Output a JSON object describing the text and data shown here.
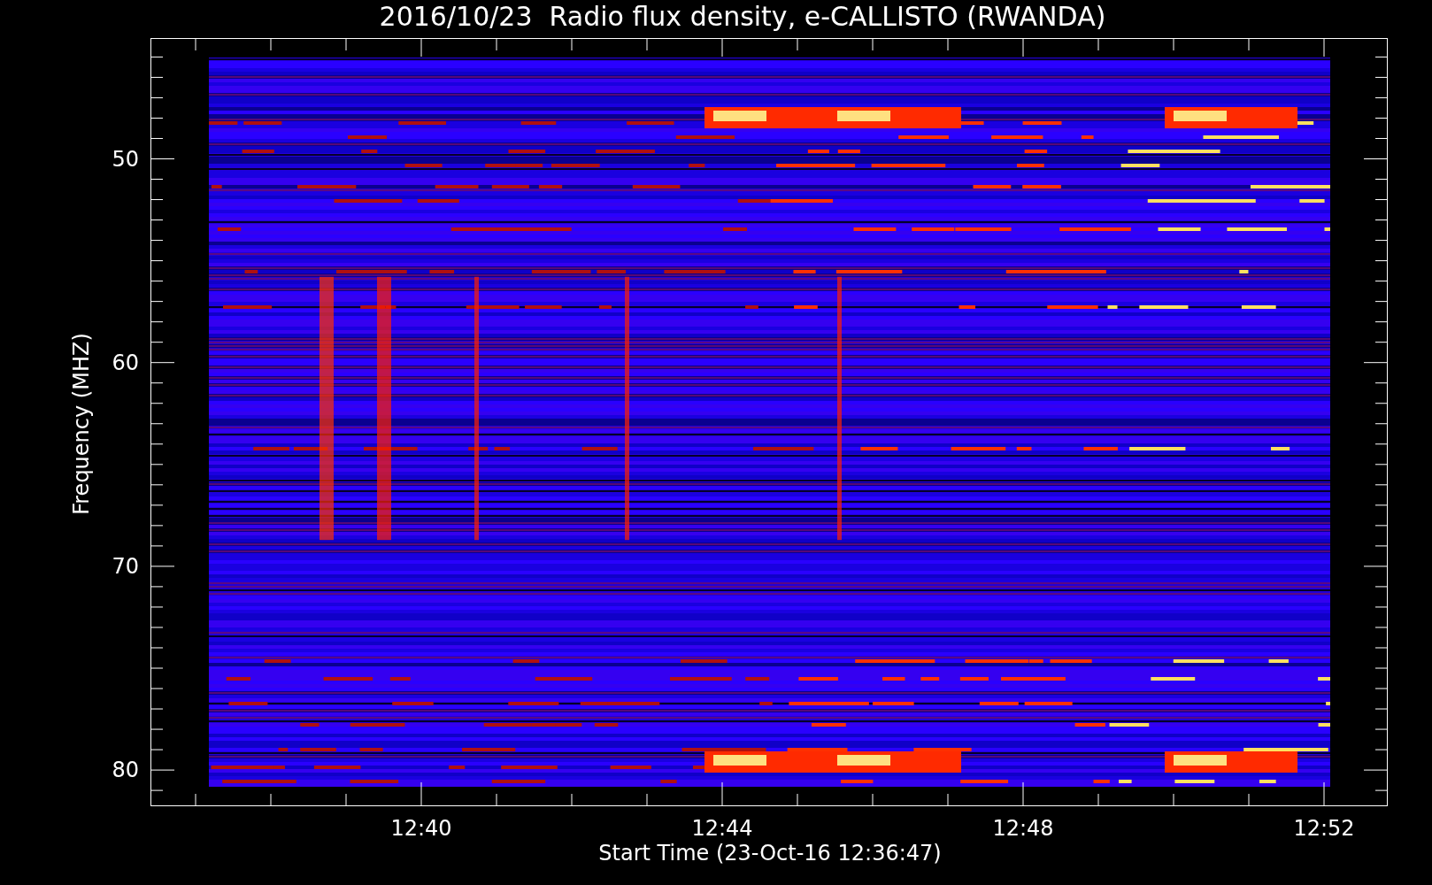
{
  "title": "2016/10/23  Radio flux density, e-CALLISTO (RWANDA)",
  "y_axis": {
    "label": "Frequency (MHZ)",
    "ticks": [
      "50",
      "60",
      "70",
      "80"
    ]
  },
  "x_axis": {
    "label": "Start Time (23-Oct-16 12:36:47)",
    "ticks": [
      "12:40",
      "12:44",
      "12:48",
      "12:52"
    ]
  }
}
